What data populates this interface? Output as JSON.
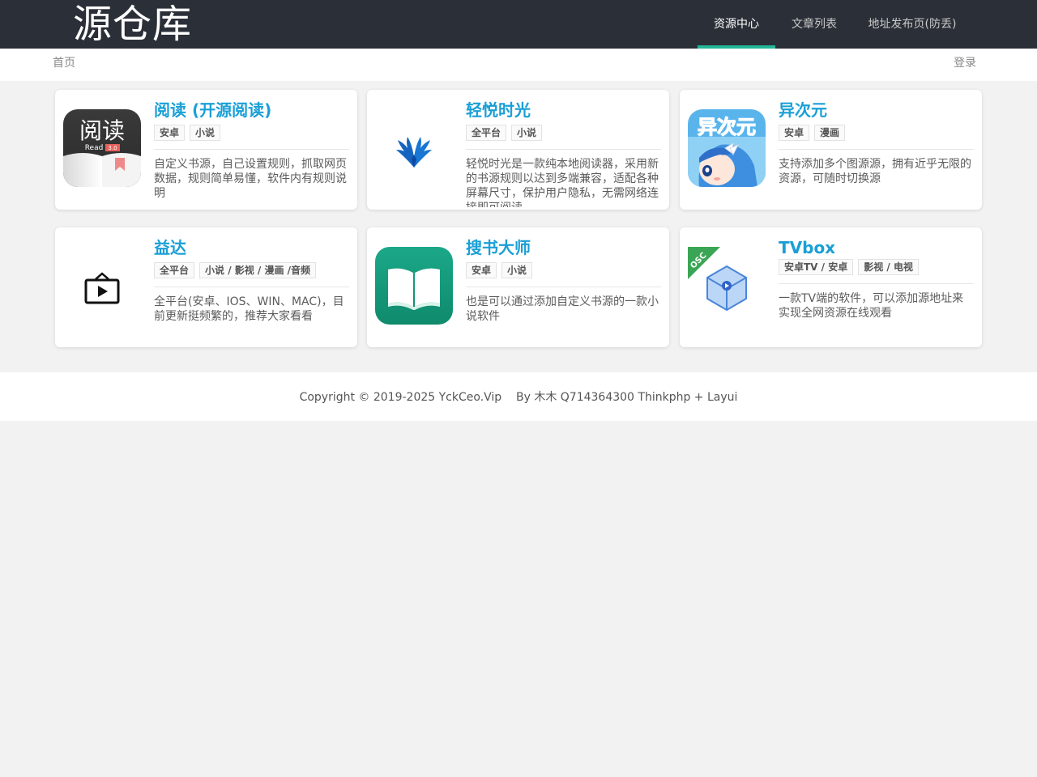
{
  "header": {
    "logo": "源仓库",
    "nav": [
      {
        "label": "资源中心",
        "active": true
      },
      {
        "label": "文章列表",
        "active": false
      },
      {
        "label": "地址发布页(防丢)",
        "active": false
      }
    ]
  },
  "subbar": {
    "home": "首页",
    "login": "登录"
  },
  "icon_texts": {
    "yuedu_cn": "阅读",
    "yuedu_read": "Read",
    "yuedu_ver": "3.0",
    "yiciyuan": "异次元",
    "osc": "OSC"
  },
  "cards": [
    {
      "title": "阅读 (开源阅读)",
      "tags": [
        "安卓",
        "小说"
      ],
      "desc": "自定义书源，自己设置规则，抓取网页数据，规则简单易懂，软件内有规则说明",
      "icon": "yuedu-app-icon"
    },
    {
      "title": "轻悦时光",
      "tags": [
        "全平台",
        "小说"
      ],
      "desc": "轻悦时光是一款纯本地阅读器，采用新的书源规则以达到多端兼容，适配各种屏幕尺寸，保护用户隐私，无需网络连接即可阅读",
      "icon": "wings-app-icon"
    },
    {
      "title": "异次元",
      "tags": [
        "安卓",
        "漫画"
      ],
      "desc": "支持添加多个图源源，拥有近乎无限的资源，可随时切换源",
      "icon": "anime-girl-app-icon"
    },
    {
      "title": "益达",
      "tags": [
        "全平台",
        "小说 / 影视 / 漫画 /音频"
      ],
      "desc": "全平台(安卓、IOS、WIN、MAC)，目前更新挺频繁的，推荐大家看看",
      "icon": "live-tv-app-icon"
    },
    {
      "title": "搜书大师",
      "tags": [
        "安卓",
        "小说"
      ],
      "desc": "也是可以通过添加自定义书源的一款小说软件",
      "icon": "open-book-app-icon"
    },
    {
      "title": "TVbox",
      "tags": [
        "安卓TV / 安卓",
        "影视 / 电视"
      ],
      "desc": "一款TV端的软件，可以添加源地址来实现全网资源在线观看",
      "icon": "cube-play-app-icon"
    }
  ],
  "footer": {
    "text": "Copyright © 2019-2025 YckCeo.Vip    By 木木 Q714364300 Thinkphp + Layui"
  },
  "colors": {
    "header_bg": "#2b3038",
    "accent": "#23b696",
    "title": "#1a9fd6",
    "page_bg": "#f2f2f2"
  }
}
